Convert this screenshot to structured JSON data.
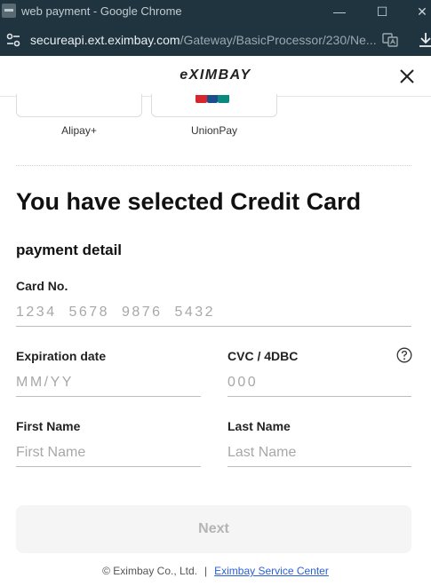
{
  "window": {
    "title": "web payment - Google Chrome",
    "min_symbol": "—",
    "max_symbol": "☐",
    "close_symbol": "✕"
  },
  "addressbar": {
    "url_host": "secureapi.ext.eximbay.com",
    "url_path": "/Gateway/BasicProcessor/230/Ne..."
  },
  "header": {
    "logo_text": "eXIMBAY"
  },
  "payment_methods": [
    {
      "label": "Alipay+"
    },
    {
      "label": "UnionPay"
    }
  ],
  "colors": {
    "unionpay_red": "#d7262e",
    "unionpay_blue": "#1c4d8c",
    "unionpay_green": "#0a8a7f",
    "link": "#2a5fd6"
  },
  "main": {
    "selected_title": "You have selected Credit Card",
    "section_title": "payment detail",
    "card_no": {
      "label": "Card No.",
      "placeholder": "1234  5678  9876  5432",
      "value": ""
    },
    "expiration": {
      "label": "Expiration date",
      "placeholder": "MM/YY",
      "value": ""
    },
    "cvc": {
      "label": "CVC / 4DBC",
      "placeholder": "000",
      "value": ""
    },
    "first_name": {
      "label": "First Name",
      "placeholder": "First Name",
      "value": ""
    },
    "last_name": {
      "label": "Last Name",
      "placeholder": "Last Name",
      "value": ""
    },
    "next_label": "Next"
  },
  "footer": {
    "copyright": "© Eximbay Co., Ltd.",
    "separator": "|",
    "service_link": "Eximbay Service Center"
  },
  "icons": {
    "site_info": "tune-icon",
    "translate": "translate-icon",
    "download": "download-icon",
    "close": "close-icon",
    "help": "help-icon"
  }
}
